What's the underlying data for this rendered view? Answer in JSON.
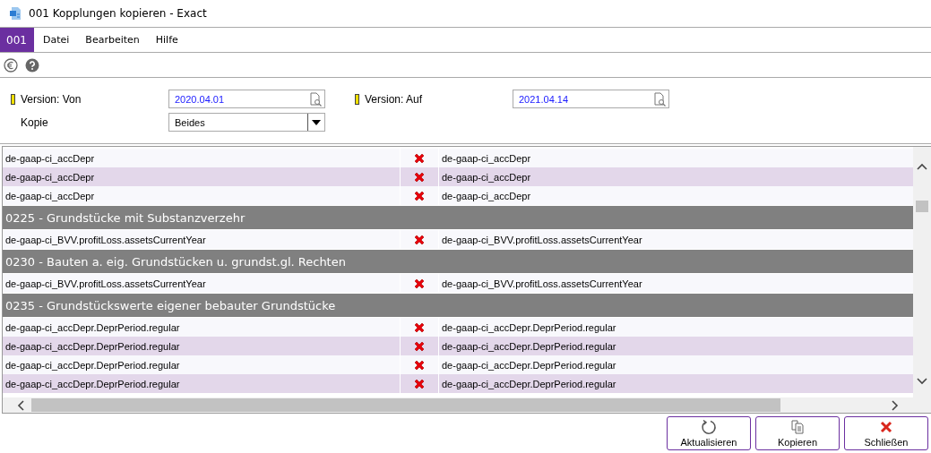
{
  "window": {
    "title": "001 Kopplungen kopieren - Exact"
  },
  "menu": {
    "badge": "001",
    "items": [
      {
        "label": "Datei"
      },
      {
        "label": "Bearbeiten"
      },
      {
        "label": "Hilfe"
      }
    ]
  },
  "form": {
    "version_from": {
      "label": "Version: Von",
      "value": "2020.04.01"
    },
    "version_to": {
      "label": "Version: Auf",
      "value": "2021.04.14"
    },
    "copy": {
      "label": "Kopie",
      "value": "Beides"
    }
  },
  "table": {
    "rows": [
      {
        "kind": "row",
        "source": "de-gaap-ci_accDepr",
        "target": "de-gaap-ci_accDepr"
      },
      {
        "kind": "row",
        "source": "de-gaap-ci_accDepr",
        "target": "de-gaap-ci_accDepr"
      },
      {
        "kind": "row",
        "source": "de-gaap-ci_accDepr",
        "target": "de-gaap-ci_accDepr"
      },
      {
        "kind": "group",
        "title": "0225 - Grundstücke mit Substanzverzehr"
      },
      {
        "kind": "row",
        "source": "de-gaap-ci_BVV.profitLoss.assetsCurrentYear",
        "target": "de-gaap-ci_BVV.profitLoss.assetsCurrentYear"
      },
      {
        "kind": "group",
        "title": "0230 - Bauten a. eig. Grundstücken u. grundst.gl. Rechten"
      },
      {
        "kind": "row",
        "source": "de-gaap-ci_BVV.profitLoss.assetsCurrentYear",
        "target": "de-gaap-ci_BVV.profitLoss.assetsCurrentYear"
      },
      {
        "kind": "group",
        "title": "0235 - Grundstückswerte eigener bebauter Grundstücke"
      },
      {
        "kind": "row",
        "source": "de-gaap-ci_accDepr.DeprPeriod.regular",
        "target": "de-gaap-ci_accDepr.DeprPeriod.regular"
      },
      {
        "kind": "row",
        "source": "de-gaap-ci_accDepr.DeprPeriod.regular",
        "target": "de-gaap-ci_accDepr.DeprPeriod.regular"
      },
      {
        "kind": "row",
        "source": "de-gaap-ci_accDepr.DeprPeriod.regular",
        "target": "de-gaap-ci_accDepr.DeprPeriod.regular"
      },
      {
        "kind": "row",
        "source": "de-gaap-ci_accDepr.DeprPeriod.regular",
        "target": "de-gaap-ci_accDepr.DeprPeriod.regular"
      }
    ]
  },
  "buttons": [
    {
      "kind": "refresh",
      "label": "Aktualisieren"
    },
    {
      "kind": "copy",
      "label": "Kopieren"
    },
    {
      "kind": "close",
      "label": "Schließen"
    }
  ]
}
